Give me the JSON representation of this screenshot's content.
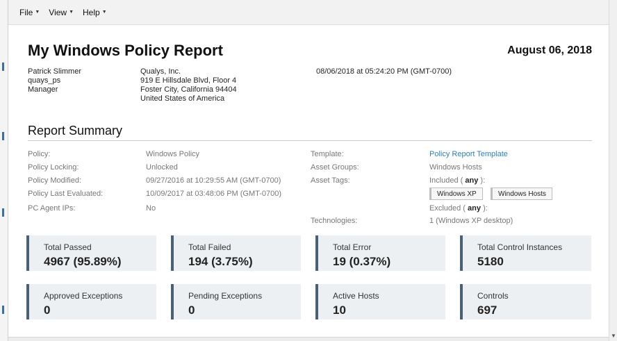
{
  "menubar": {
    "items": [
      {
        "label": "File"
      },
      {
        "label": "View"
      },
      {
        "label": "Help"
      }
    ]
  },
  "report": {
    "title": "My Windows Policy Report",
    "date": "August 06, 2018",
    "user": {
      "name": "Patrick Slimmer",
      "username": "quays_ps",
      "role": "Manager"
    },
    "company": {
      "name": "Qualys, Inc.",
      "address1": "919 E Hillsdale Blvd, Floor 4",
      "address2": "Foster City, California 94404",
      "country": "United States of America"
    },
    "generated": "08/06/2018 at 05:24:20 PM (GMT-0700)"
  },
  "summary": {
    "title": "Report Summary",
    "policy_label": "Policy:",
    "policy_value": "Windows Policy",
    "locking_label": "Policy Locking:",
    "locking_value": "Unlocked",
    "modified_label": "Policy Modified:",
    "modified_value": "09/27/2016 at 10:29:55 AM (GMT-0700)",
    "evaluated_label": "Policy Last Evaluated:",
    "evaluated_value": "10/09/2017 at 03:48:06 PM (GMT-0700)",
    "agent_label": "PC Agent IPs:",
    "agent_value": "No",
    "template_label": "Template:",
    "template_value": "Policy Report Template",
    "asset_groups_label": "Asset Groups:",
    "asset_groups_value": "Windows Hosts",
    "asset_tags_label": "Asset Tags:",
    "included_prefix": "Included (",
    "included_any": "any",
    "included_suffix": "):",
    "tags": [
      "Windows XP",
      "Windows Hosts"
    ],
    "excluded_prefix": "Excluded (",
    "excluded_any": "any",
    "excluded_suffix": "):",
    "technologies_label": "Technologies:",
    "technologies_value": "1 (Windows XP desktop)"
  },
  "stats": [
    {
      "label": "Total Passed",
      "value": "4967 (95.89%)"
    },
    {
      "label": "Total Failed",
      "value": "194 (3.75%)"
    },
    {
      "label": "Total Error",
      "value": "19 (0.37%)"
    },
    {
      "label": "Total Control Instances",
      "value": "5180"
    },
    {
      "label": "Approved Exceptions",
      "value": "0"
    },
    {
      "label": "Pending Exceptions",
      "value": "0"
    },
    {
      "label": "Active Hosts",
      "value": "10"
    },
    {
      "label": "Controls",
      "value": "697"
    }
  ],
  "colors": {
    "link": "#2a7fc1",
    "card_background": "#edf0f2",
    "card_accent": "#4a6075"
  }
}
